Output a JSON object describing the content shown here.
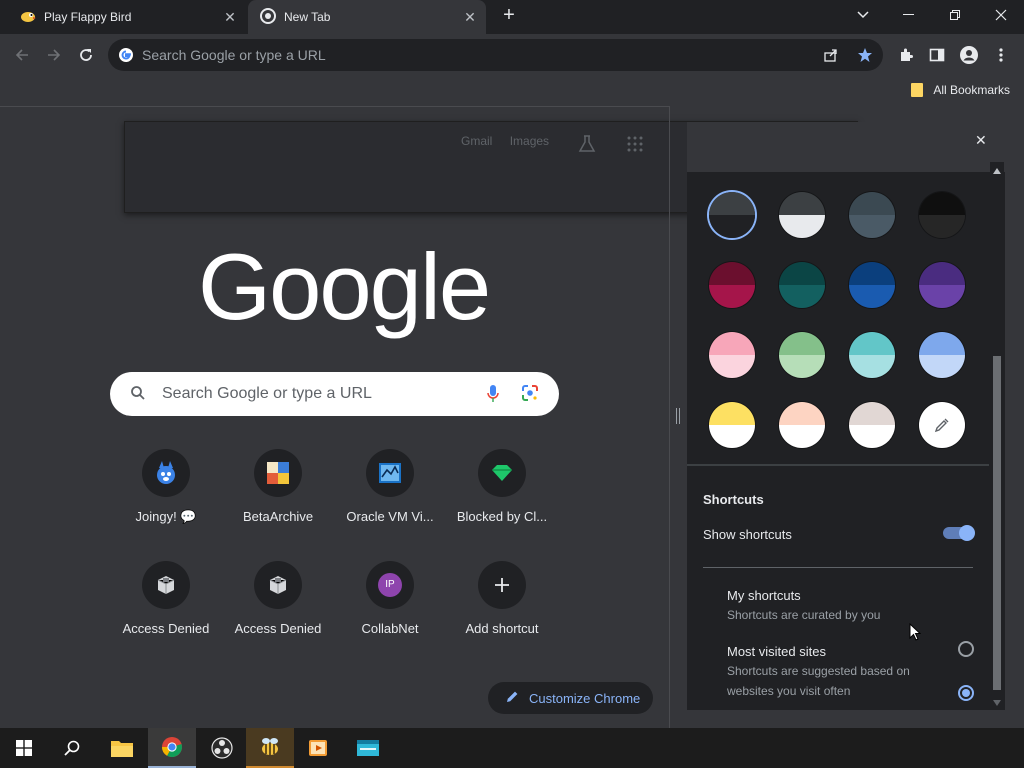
{
  "tabs": [
    {
      "title": "Play Flappy Bird",
      "active": false
    },
    {
      "title": "New Tab",
      "active": true
    }
  ],
  "omnibox": {
    "placeholder": "Search Google or type a URL"
  },
  "bookmarks": {
    "all_bookmarks": "All Bookmarks"
  },
  "ntp": {
    "ghost_links": [
      "Gmail",
      "Images"
    ],
    "logo": "Google",
    "search_placeholder": "Search Google or type a URL",
    "shortcuts": [
      {
        "label": "Joingy! 💬",
        "icon": "joingy-icon"
      },
      {
        "label": "BetaArchive",
        "icon": "betaarchive-icon"
      },
      {
        "label": "Oracle VM Vi...",
        "icon": "oracle-vm-icon"
      },
      {
        "label": "Blocked by Cl...",
        "icon": "blocked-icon"
      },
      {
        "label": "Access Denied",
        "icon": "access-denied-icon"
      },
      {
        "label": "Access Denied",
        "icon": "access-denied-icon"
      },
      {
        "label": "CollabNet",
        "icon": "collabnet-icon",
        "letters": "IP"
      },
      {
        "label": "Add shortcut",
        "icon": "plus-icon"
      }
    ],
    "customize_label": "Customize Chrome"
  },
  "side_panel": {
    "swatches": [
      {
        "top": "#3c4043",
        "bot": "#202124",
        "selected": true
      },
      {
        "top": "#3c4043",
        "bot": "#e8eaed"
      },
      {
        "top": "#3b4952",
        "bot": "#4a5a66"
      },
      {
        "top": "#0f0f0f",
        "bot": "#262626"
      },
      {
        "top": "#6b0f2e",
        "bot": "#a5154a"
      },
      {
        "top": "#0b4545",
        "bot": "#136060"
      },
      {
        "top": "#0b3f7d",
        "bot": "#1a5bb0"
      },
      {
        "top": "#4a2c80",
        "bot": "#6a42a8"
      },
      {
        "top": "#f7a6b9",
        "bot": "#fbd4de"
      },
      {
        "top": "#84c08a",
        "bot": "#b6deb8"
      },
      {
        "top": "#62c6c8",
        "bot": "#a6e0e2"
      },
      {
        "top": "#7ea8ec",
        "bot": "#c2d7f8"
      },
      {
        "top": "#fde062",
        "bot": "#ffffff"
      },
      {
        "top": "#fdd4c2",
        "bot": "#ffffff"
      },
      {
        "top": "#e1d7d4",
        "bot": "#ffffff"
      },
      {
        "top": "#ffffff",
        "bot": "#ffffff",
        "picker": true
      }
    ],
    "shortcuts_title": "Shortcuts",
    "show_shortcuts": "Show shortcuts",
    "options": [
      {
        "title": "My shortcuts",
        "subtitle": "Shortcuts are curated by you",
        "selected": true
      },
      {
        "title": "Most visited sites",
        "subtitle": "Shortcuts are suggested based on websites you visit often",
        "selected": false
      }
    ]
  },
  "colors": {
    "accent": "#8ab4f8",
    "panel_bg": "#202124",
    "page_bg": "#35363a"
  }
}
